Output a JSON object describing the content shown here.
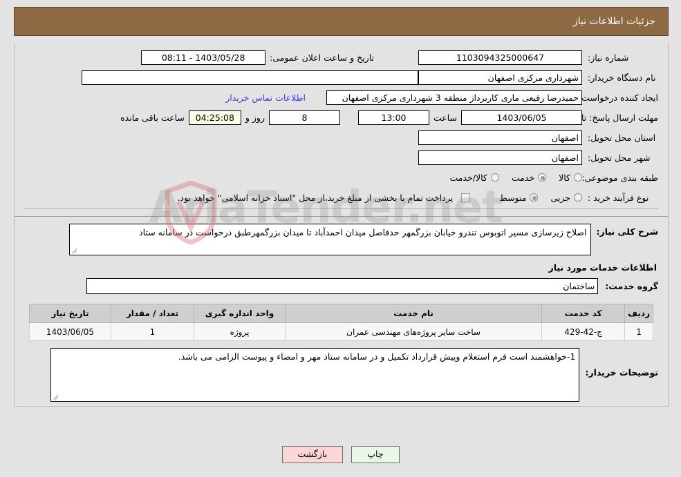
{
  "header": {
    "title": "جزئیات اطلاعات نیاز"
  },
  "top_form": {
    "need_number_label": "شماره نیاز:",
    "need_number_value": "1103094325000647",
    "announce_datetime_label": "تاریخ و ساعت اعلان عمومی:",
    "announce_datetime_value": "1403/05/28 - 08:11",
    "buyer_org_label": "نام دستگاه خریدار:",
    "buyer_org_value": "شهرداری مرکزی اصفهان",
    "buyer_org_value2": "شهرداری مرکزی اصفهان",
    "requester_label": "ایجاد کننده درخواست:",
    "requester_value": "حمیدرضا رفیعی ماری کاربرداز منطقه 3 شهرداری مرکزی اصفهان",
    "contact_link": "اطلاعات تماس خریدار",
    "deadline_label": "مهلت ارسال پاسخ: تا تاریخ:",
    "deadline_date": "1403/06/05",
    "hour_label": "ساعت",
    "hour_value": "13:00",
    "days_value": "8",
    "days_label": "روز و",
    "countdown_value": "04:25:08",
    "countdown_label": "ساعت باقی مانده",
    "province_label": "استان محل تحویل:",
    "province_value": "اصفهان",
    "city_label": "شهر محل تحویل:",
    "city_value": "اصفهان",
    "category_label": "طبقه بندی موضوعی:",
    "category_options": [
      {
        "label": "کالا",
        "selected": false
      },
      {
        "label": "خدمت",
        "selected": true
      },
      {
        "label": "کالا/خدمت",
        "selected": false
      }
    ],
    "process_label": "نوع فرآیند خرید :",
    "process_options": [
      {
        "label": "جزیی",
        "selected": false
      },
      {
        "label": "متوسط",
        "selected": true
      }
    ],
    "treasury_checkbox_checked": false,
    "treasury_text": "پرداخت تمام یا بخشی از مبلغ خرید،از محل \"اسناد خزانه اسلامی\" خواهد بود."
  },
  "description": {
    "label": "شرح کلی نیاز:",
    "value": "اصلاح زیرسازی مسیر اتوبوس تندرو خیابان بزرگمهر حدفاصل میدان احمدآباد تا میدان بزرگمهرطبق درخواست در سامانه ستاد"
  },
  "services_section": {
    "heading": "اطلاعات خدمات مورد نیاز",
    "group_label": "گروه خدمت:",
    "group_value": "ساختمان"
  },
  "table": {
    "columns": [
      "ردیف",
      "کد خدمت",
      "نام خدمت",
      "واحد اندازه گیری",
      "تعداد / مقدار",
      "تاریخ نیاز"
    ],
    "rows": [
      {
        "row": "1",
        "code": "ج-42-429",
        "name": "ساخت سایر پروژه‌های مهندسی عمران",
        "unit": "پروژه",
        "qty": "1",
        "date": "1403/06/05"
      }
    ]
  },
  "notes": {
    "label": "توضیحات خریدار:",
    "value": "1-خواهشمند است فرم استعلام وپیش قرارداد تکمیل و در سامانه ستاد مهر و امضاء و پیوست الزامی می باشد."
  },
  "buttons": {
    "print": "چاپ",
    "back": "بازگشت"
  },
  "watermark": {
    "text": "AriaTender.net"
  },
  "colors": {
    "header_bg": "#8d6a43",
    "page_bg": "#e3e3e3",
    "link": "#3d3df0",
    "table_header": "#cfcfcf",
    "btn_print": "#e9f7e9",
    "btn_back": "#fbd6d6",
    "countdown_bg": "#fbfbe8"
  }
}
